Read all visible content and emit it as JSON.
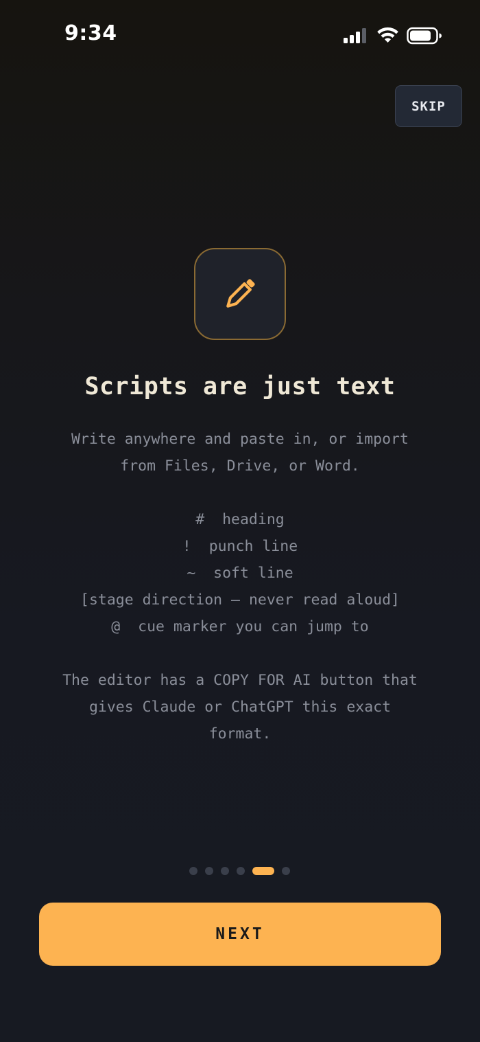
{
  "status_bar": {
    "time": "9:34",
    "icons": [
      "cellular-signal-icon",
      "wifi-icon",
      "battery-icon"
    ]
  },
  "header": {
    "skip_label": "SKIP"
  },
  "hero": {
    "icon": "pencil-icon",
    "title": "Scripts are just text"
  },
  "body": {
    "intro_lines": [
      "Write anywhere and paste in, or import",
      "from Files, Drive, or Word."
    ],
    "syntax_lines": [
      "#  heading",
      "!  punch line",
      "~  soft line",
      "[stage direction — never read aloud]",
      "@  cue marker you can jump to"
    ],
    "outro_lines": [
      "The editor has a COPY FOR AI button that",
      "gives Claude or ChatGPT this exact",
      "format."
    ]
  },
  "pager": {
    "total_pages": 6,
    "current_page": 5
  },
  "footer": {
    "next_label": "NEXT"
  },
  "colors": {
    "accent": "#fdb351",
    "background": "#171a22",
    "tile_border": "#8a6a33",
    "muted_text": "#8a8e99",
    "title_text": "#efe8d6"
  }
}
